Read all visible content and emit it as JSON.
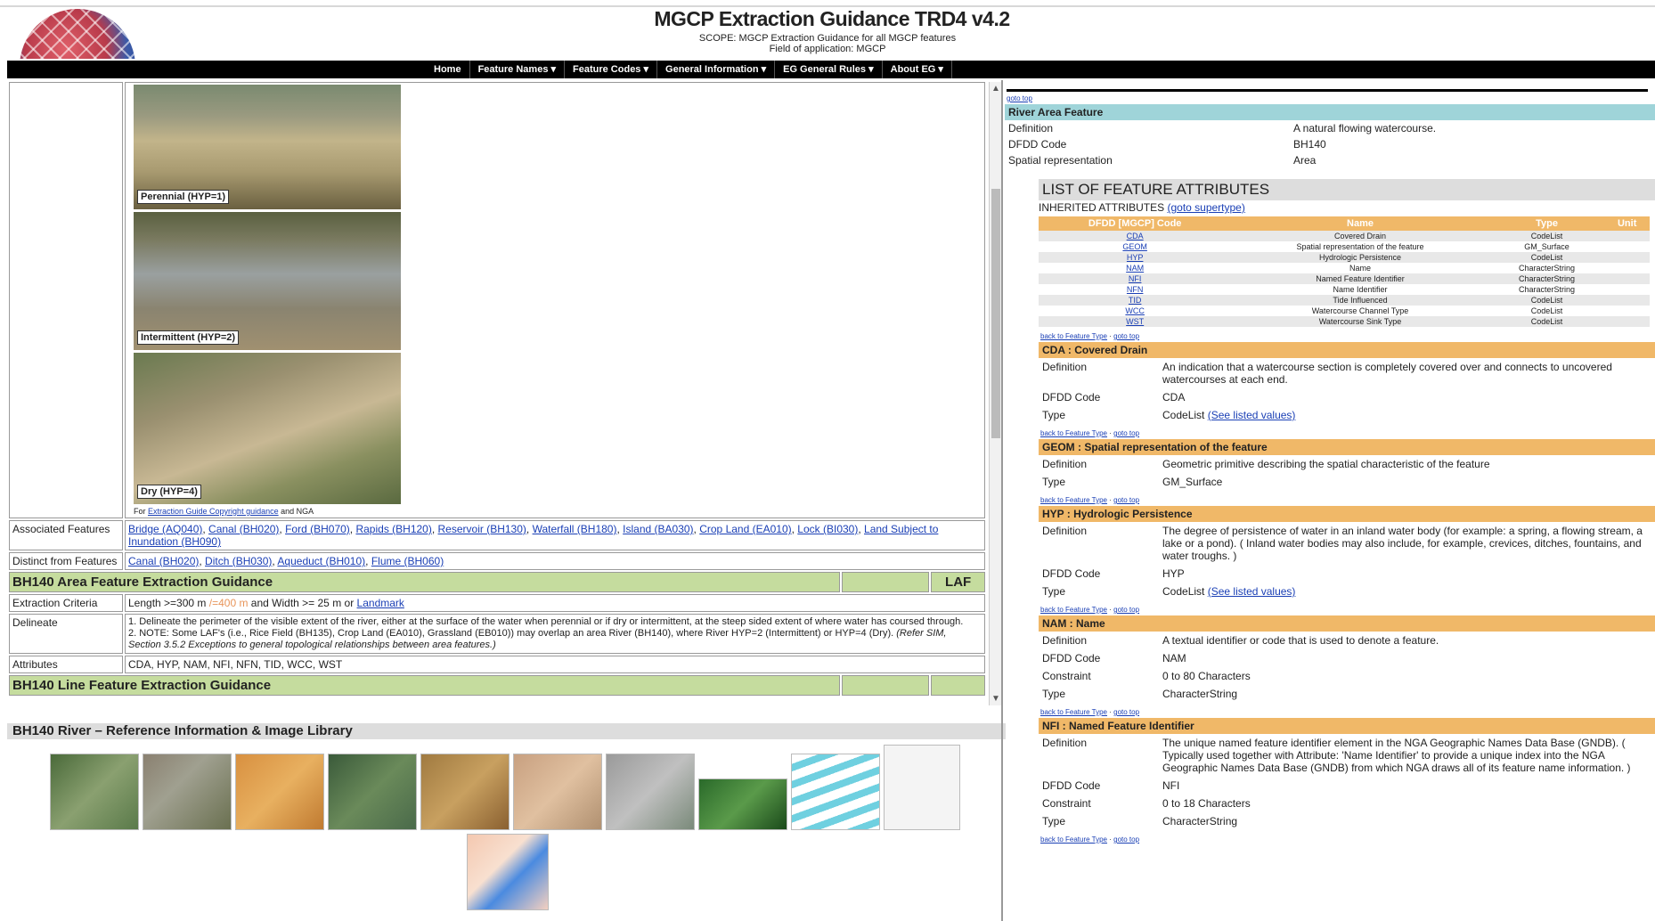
{
  "header": {
    "title": "MGCP Extraction Guidance TRD4 v4.2",
    "scope": "SCOPE: MGCP Extraction Guidance for all MGCP features",
    "field": "Field of application: MGCP"
  },
  "nav": [
    "Home",
    "Feature Names ▾",
    "Feature Codes ▾",
    "General Information ▾",
    "EG General Rules ▾",
    "About EG ▾"
  ],
  "left": {
    "photos": [
      "Perennial (HYP=1)",
      "Intermittent (HYP=2)",
      "Dry (HYP=4)"
    ],
    "photo_credit_prefix": "For",
    "photo_credit_link": "Extraction Guide Copyright guidance",
    "photo_credit_suffix": "and NGA",
    "associated_label": "Associated Features",
    "associated": [
      "Bridge (AQ040)",
      "Canal (BH020)",
      "Ford (BH070)",
      "Rapids (BH120)",
      "Reservoir (BH130)",
      "Waterfall (BH180)",
      "Island (BA030)",
      "Crop Land (EA010)",
      "Lock (BI030)",
      "Land Subject to Inundation (BH090)"
    ],
    "distinct_label": "Distinct from Features",
    "distinct": [
      "Canal (BH020)",
      "Ditch (BH030)",
      "Aqueduct (BH010)",
      "Flume (BH060)"
    ],
    "area_heading": "BH140 Area Feature Extraction Guidance",
    "area_code": "LAF",
    "criteria_label": "Extraction Criteria",
    "criteria_a": "Length >=300 m",
    "criteria_b": "/=400 m",
    "criteria_c": "and Width >= 25 m or",
    "criteria_link": "Landmark",
    "delineate_label": "Delineate",
    "delineate_1": "1. Delineate the perimeter of the visible extent of the river, either at the surface of the water when perennial or if dry or intermittent, at the steep sided extent of where water has coursed through.",
    "delineate_2": "2. NOTE: Some LAF's (i.e., Rice Field (BH135), Crop Land (EA010), Grassland (EB010)) may overlap an area River (BH140), where River HYP=2 (Intermittent) or HYP=4 (Dry).",
    "delineate_2i": "(Refer SIM, Section 3.5.2 Exceptions to general topological relationships between area features.)",
    "attributes_label": "Attributes",
    "attributes": "CDA, HYP, NAM, NFI, NFN, TID, WCC, WST",
    "line_heading": "BH140 Line Feature Extraction Guidance"
  },
  "library": {
    "heading": "BH140 River – Reference Information & Image Library"
  },
  "right": {
    "top_link": "goto top",
    "feature_title": "River Area Feature",
    "definition_label": "Definition",
    "definition": "A natural flowing watercourse.",
    "dfdd_label": "DFDD Code",
    "dfdd": "BH140",
    "spatial_label": "Spatial representation",
    "spatial": "Area",
    "lfa_heading": "LIST OF FEATURE ATTRIBUTES",
    "inherited": "INHERITED ATTRIBUTES",
    "goto_supertype": "(goto supertype)",
    "table_headers": [
      "DFDD [MGCP] Code",
      "Name",
      "Type",
      "Unit"
    ],
    "table_rows": [
      {
        "code": "CDA",
        "name": "Covered Drain",
        "type": "CodeList"
      },
      {
        "code": "GEOM",
        "name": "Spatial representation of the feature",
        "type": "GM_Surface"
      },
      {
        "code": "HYP",
        "name": "Hydrologic Persistence",
        "type": "CodeList"
      },
      {
        "code": "NAM",
        "name": "Name",
        "type": "CharacterString"
      },
      {
        "code": "NFI",
        "name": "Named Feature Identifier",
        "type": "CharacterString"
      },
      {
        "code": "NFN",
        "name": "Name Identifier",
        "type": "CharacterString"
      },
      {
        "code": "TID",
        "name": "Tide Influenced",
        "type": "CodeList"
      },
      {
        "code": "WCC",
        "name": "Watercourse Channel Type",
        "type": "CodeList"
      },
      {
        "code": "WST",
        "name": "Watercourse Sink Type",
        "type": "CodeList"
      }
    ],
    "back_link": "back to Feature Type",
    "top_link2": "goto top",
    "attrs": [
      {
        "head": "CDA : Covered Drain",
        "rows": [
          {
            "k": "Definition",
            "v": "An indication that a watercourse section is completely covered over and connects to uncovered watercourses at each end."
          },
          {
            "k": "DFDD Code",
            "v": "CDA"
          },
          {
            "k": "Type",
            "v": "CodeList",
            "link": "(See listed values)"
          }
        ]
      },
      {
        "head": "GEOM : Spatial representation of the feature",
        "rows": [
          {
            "k": "Definition",
            "v": "Geometric primitive describing the spatial characteristic of the feature"
          },
          {
            "k": "Type",
            "v": "GM_Surface"
          }
        ]
      },
      {
        "head": "HYP : Hydrologic Persistence",
        "rows": [
          {
            "k": "Definition",
            "v": "The degree of persistence of water in an inland water body (for example: a spring, a flowing stream, a lake or a pond). ( Inland water bodies may also include, for example, crevices, ditches, fountains, and water troughs. )"
          },
          {
            "k": "DFDD Code",
            "v": "HYP"
          },
          {
            "k": "Type",
            "v": "CodeList",
            "link": "(See listed values)"
          }
        ]
      },
      {
        "head": "NAM : Name",
        "rows": [
          {
            "k": "Definition",
            "v": "A textual identifier or code that is used to denote a feature."
          },
          {
            "k": "DFDD Code",
            "v": "NAM"
          },
          {
            "k": "Constraint",
            "v": "0 to 80 Characters"
          },
          {
            "k": "Type",
            "v": "CharacterString"
          }
        ]
      },
      {
        "head": "NFI : Named Feature Identifier",
        "rows": [
          {
            "k": "Definition",
            "v": "The unique named feature identifier element in the NGA Geographic Names Data Base (GNDB). ( Typically used together with Attribute: 'Name Identifier' to provide a unique index into the NGA Geographic Names Data Base (GNDB) from which NGA draws all of its feature name information. )"
          },
          {
            "k": "DFDD Code",
            "v": "NFI"
          },
          {
            "k": "Constraint",
            "v": "0 to 18 Characters"
          },
          {
            "k": "Type",
            "v": "CharacterString"
          }
        ]
      }
    ]
  },
  "colors": {
    "nav_bg": "#000000",
    "section_green": "#c5dc9e",
    "attr_orange": "#f0b868",
    "feature_teal": "#9fd4d9"
  }
}
